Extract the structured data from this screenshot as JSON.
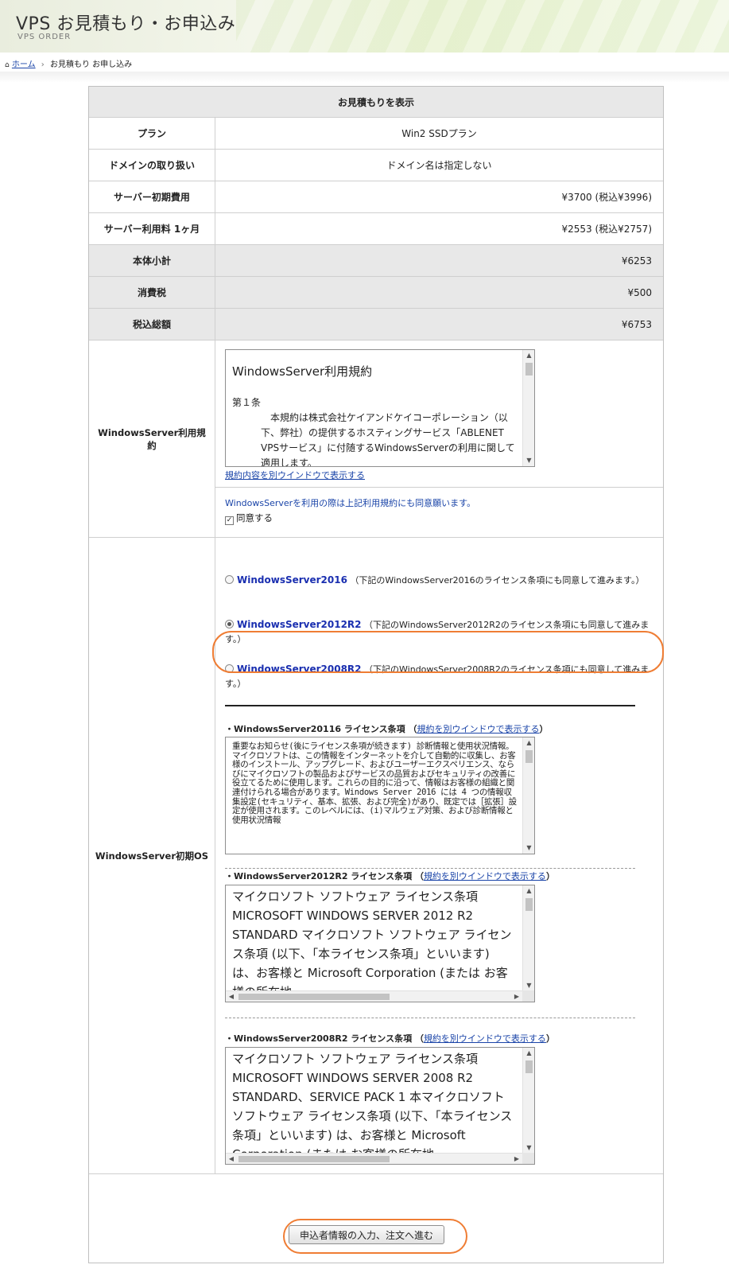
{
  "header": {
    "title": "VPS お見積もり・お申込み",
    "subtitle": "VPS ORDER"
  },
  "breadcrumb": {
    "home": "ホーム",
    "current": "お見積もり お申し込み"
  },
  "estimate": {
    "heading": "お見積もりを表示",
    "rows": [
      {
        "label": "プラン",
        "value": "Win2 SSDプラン"
      },
      {
        "label": "ドメインの取り扱い",
        "value": "ドメイン名は指定しない"
      },
      {
        "label": "サーバー初期費用",
        "value": "¥3700 (税込¥3996)"
      },
      {
        "label": "サーバー利用料 1ヶ月",
        "value": "¥2553 (税込¥2757)"
      },
      {
        "label": "本体小計",
        "value": "¥6253"
      },
      {
        "label": "消費税",
        "value": "¥500"
      },
      {
        "label": "税込総額",
        "value": "¥6753"
      }
    ]
  },
  "terms": {
    "label": "WindowsServer利用規約",
    "title": "WindowsServer利用規約",
    "article": "第１条",
    "body": "本規約は株式会社ケイアンドケイコーポレーション（以下、弊社）の提供するホスティングサービス「ABLENET VPSサービス」に付随するWindowsServerの利用に関して適用します。",
    "open_link": "規約内容を別ウインドウで表示する",
    "agree_note": "WindowsServerを利用の際は上記利用規約にも同意願います。",
    "agree_label": "同意する",
    "agree_checked": true
  },
  "os": {
    "label": "WindowsServer初期OS",
    "options": [
      {
        "name": "WindowsServer2016",
        "note": "（下記のWindowsServer2016のライセンス条項にも同意して進みます。）",
        "checked": false
      },
      {
        "name": "WindowsServer2012R2",
        "note": "（下記のWindowsServer2012R2のライセンス条項にも同意して進みます。）",
        "checked": true
      },
      {
        "name": "WindowsServer2008R2",
        "note": "（下記のWindowsServer2008R2のライセンス条項にも同意して進みます。）",
        "checked": false
      }
    ],
    "licenses": [
      {
        "heading": "・WindowsServer20116 ライセンス条項",
        "paren_open": "（",
        "link": "規約を別ウインドウで表示する",
        "paren_close": "）",
        "text": "重要なお知らせ(後にライセンス条項が続きます) 診断情報と使用状況情報。マイクロソフトは、この情報をインターネットを介して自動的に収集し、お客様のインストール、アップグレード、およびユーザーエクスペリエンス、ならびにマイクロソフトの製品およびサービスの品質およびセキュリティの改善に役立てるために使用します。これらの目的に沿って、情報はお客様の組織と関連付けられる場合があります。Windows Server 2016 には 4 つの情報収集設定(セキュリティ、基本、拡張、および完全)があり、既定では［拡張］設定が使用されます。このレベルには、(i)マルウェア対策、および診断情報と使用状況情報"
      },
      {
        "heading": "・WindowsServer2012R2 ライセンス条項",
        "paren_open": "（",
        "link": "規約を別ウインドウで表示する",
        "paren_close": "）",
        "text": "マイクロソフト ソフトウェア ライセンス条項 MICROSOFT WINDOWS SERVER 2012 R2 STANDARD マイクロソフト ソフトウェア ライセンス条項 (以下、「本ライセンス条項」といいます) は、お客様と Microsoft Corporation (または お客様の所在地"
      },
      {
        "heading": "・WindowsServer2008R2 ライセンス条項",
        "paren_open": "（",
        "link": "規約を別ウインドウで表示する",
        "paren_close": "）",
        "text": "マイクロソフト ソフトウェア ライセンス条項 MICROSOFT WINDOWS SERVER 2008 R2 STANDARD、SERVICE PACK 1 本マイクロソフト ソフトウェア ライセンス条項 (以下、「本ライセンス条項」といいます) は、お客様と Microsoft Corporation (または お客様の所在地"
      }
    ]
  },
  "submit": {
    "label": "申込者情報の入力、注文へ進む"
  },
  "colors": {
    "highlight": "#ef7d34",
    "link": "#1a44a8",
    "os_name": "#1a2fb0",
    "gray_row": "#e8e8e8"
  }
}
